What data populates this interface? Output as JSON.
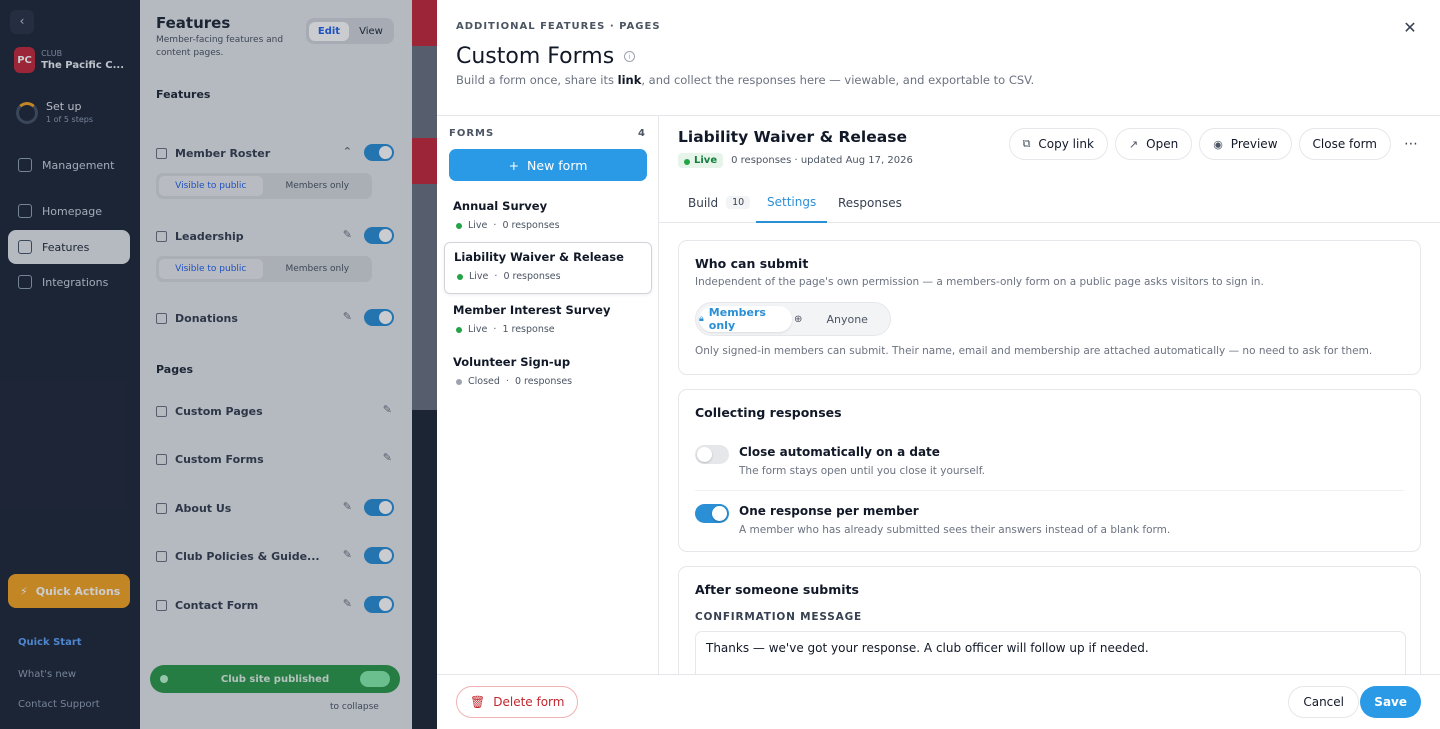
{
  "sidebar": {
    "collapse_icon": "chevron-left-icon",
    "club_initials": "PC",
    "club_label": "CLUB",
    "club_name": "The Pacific C...",
    "setup_title": "Set up",
    "setup_sub": "1 of 5 steps",
    "items": [
      {
        "label": "Management",
        "icon": "grid-icon"
      },
      {
        "label": "Homepage",
        "icon": "home-icon"
      },
      {
        "label": "Features",
        "icon": "list-icon"
      },
      {
        "label": "Integrations",
        "icon": "plug-icon"
      }
    ],
    "quick_actions": "Quick Actions",
    "quick_start": "Quick Start",
    "whats_new": "What's new",
    "contact_support": "Contact Support"
  },
  "features_panel": {
    "title": "Features",
    "subtitle": "Member-facing features and content pages.",
    "edit": "Edit",
    "view": "View",
    "features_heading": "Features",
    "pages_heading": "Pages",
    "rows": [
      {
        "label": "Member Roster"
      },
      {
        "label": "Leadership"
      },
      {
        "label": "Donations"
      },
      {
        "label": "Custom Pages"
      },
      {
        "label": "Custom Forms"
      },
      {
        "label": "About Us"
      },
      {
        "label": "Club Policies & Guide..."
      },
      {
        "label": "Contact Form"
      }
    ],
    "visible_public": "Visible to public",
    "members_only": "Members only",
    "published": "Club site published",
    "collapse_hint": "to collapse"
  },
  "drawer": {
    "breadcrumb": "ADDITIONAL FEATURES · PAGES",
    "title": "Custom Forms",
    "subtitle_pre": "Build a form once, share its ",
    "subtitle_link": "link",
    "subtitle_post": ", and collect the responses here — viewable, and exportable to CSV.",
    "close_icon": "close-icon"
  },
  "forms_list": {
    "header": "FORMS",
    "count": "4",
    "new_form": "New form",
    "items": [
      {
        "name": "Annual Survey",
        "status": "Live",
        "responses": "0 responses"
      },
      {
        "name": "Liability Waiver & Release",
        "status": "Live",
        "responses": "0 responses"
      },
      {
        "name": "Member Interest Survey",
        "status": "Live",
        "responses": "1 response"
      },
      {
        "name": "Volunteer Sign-up",
        "status": "Closed",
        "responses": "0 responses"
      }
    ]
  },
  "form_detail": {
    "name": "Liability Waiver & Release",
    "status": "Live",
    "meta": "0 responses · updated Aug 17, 2026",
    "buttons": {
      "copy_link": "Copy link",
      "open": "Open",
      "preview": "Preview",
      "close_form": "Close form"
    },
    "tabs": {
      "build": "Build",
      "build_count": "10",
      "settings": "Settings",
      "responses": "Responses"
    },
    "who": {
      "title": "Who can submit",
      "desc": "Independent of the page's own permission — a members-only form on a public page asks visitors to sign in.",
      "opt_members": "Members only",
      "opt_anyone": "Anyone",
      "note": "Only signed-in members can submit. Their name, email and membership are attached automatically — no need to ask for them."
    },
    "collecting": {
      "title": "Collecting responses",
      "auto_close_title": "Close automatically on a date",
      "auto_close_desc": "The form stays open until you close it yourself.",
      "auto_close_on": false,
      "one_resp_title": "One response per member",
      "one_resp_desc": "A member who has already submitted sees their answers instead of a blank form.",
      "one_resp_on": true
    },
    "after": {
      "title": "After someone submits",
      "label": "CONFIRMATION MESSAGE",
      "message": "Thanks — we've got your response. A club officer will follow up if needed."
    }
  },
  "footer": {
    "delete": "Delete form",
    "cancel": "Cancel",
    "save": "Save"
  },
  "colors": {
    "accent": "#2b9ae6",
    "live": "#22a447",
    "danger": "#c0262d",
    "sidebar": "#21293a"
  }
}
